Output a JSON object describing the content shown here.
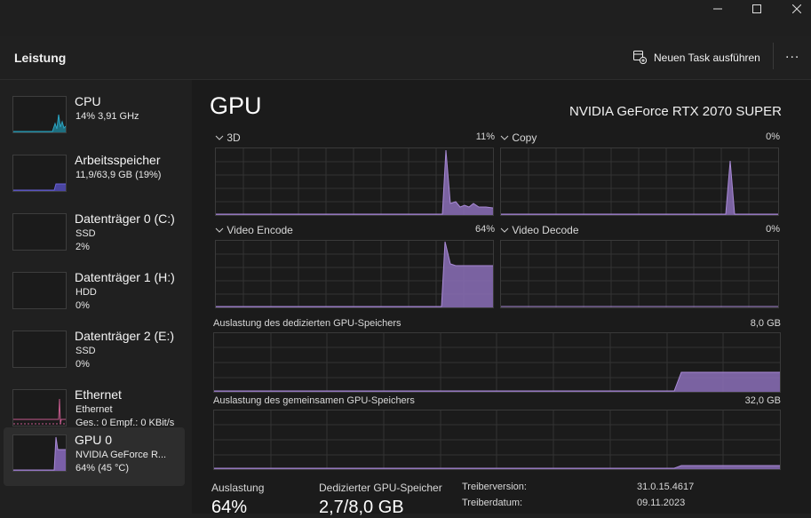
{
  "header": {
    "title": "Leistung",
    "run_task_label": "Neuen Task ausführen",
    "more_label": "..."
  },
  "sidebar": {
    "items": [
      {
        "name": "CPU",
        "line1": "14%  3,91 GHz",
        "line2": ""
      },
      {
        "name": "Arbeitsspeicher",
        "line1": "11,9/63,9 GB (19%)",
        "line2": ""
      },
      {
        "name": "Datenträger 0 (C:)",
        "line1": "SSD",
        "line2": "2%"
      },
      {
        "name": "Datenträger 1 (H:)",
        "line1": "HDD",
        "line2": "0%"
      },
      {
        "name": "Datenträger 2 (E:)",
        "line1": "SSD",
        "line2": "0%"
      },
      {
        "name": "Ethernet",
        "line1": "Ethernet",
        "line2": "Ges.: 0 Empf.: 0 KBit/s"
      },
      {
        "name": "GPU 0",
        "line1": "NVIDIA GeForce R...",
        "line2": "64%  (45 °C)"
      }
    ],
    "active_index": 6
  },
  "main": {
    "title": "GPU",
    "model": "NVIDIA GeForce RTX 2070 SUPER",
    "engines": [
      {
        "label": "3D",
        "percent": "11%"
      },
      {
        "label": "Copy",
        "percent": "0%"
      },
      {
        "label": "Video Encode",
        "percent": "64%"
      },
      {
        "label": "Video Decode",
        "percent": "0%"
      }
    ],
    "dedicated_mem": {
      "label": "Auslastung des dedizierten GPU-Speichers",
      "max": "8,0 GB"
    },
    "shared_mem": {
      "label": "Auslastung des gemeinsamen GPU-Speichers",
      "max": "32,0 GB"
    },
    "stats": {
      "utilization_label": "Auslastung",
      "utilization_value": "64%",
      "dedicated_label": "Dedizierter GPU-Speicher",
      "dedicated_value": "2,7/8,0 GB"
    },
    "details": {
      "driver_version_label": "Treiberversion:",
      "driver_version": "31.0.15.4617",
      "driver_date_label": "Treiberdatum:",
      "driver_date": "09.11.2023"
    }
  },
  "colors": {
    "gpu_accent": "#a98ad6",
    "gpu_fill": "#8b6fb8",
    "cpu_accent": "#2aa4c2",
    "mem_accent": "#6a62d8",
    "eth_accent": "#c45a8c",
    "background": "#202020",
    "panel": "#1b1b1b",
    "grid": "#3a3a3a"
  }
}
